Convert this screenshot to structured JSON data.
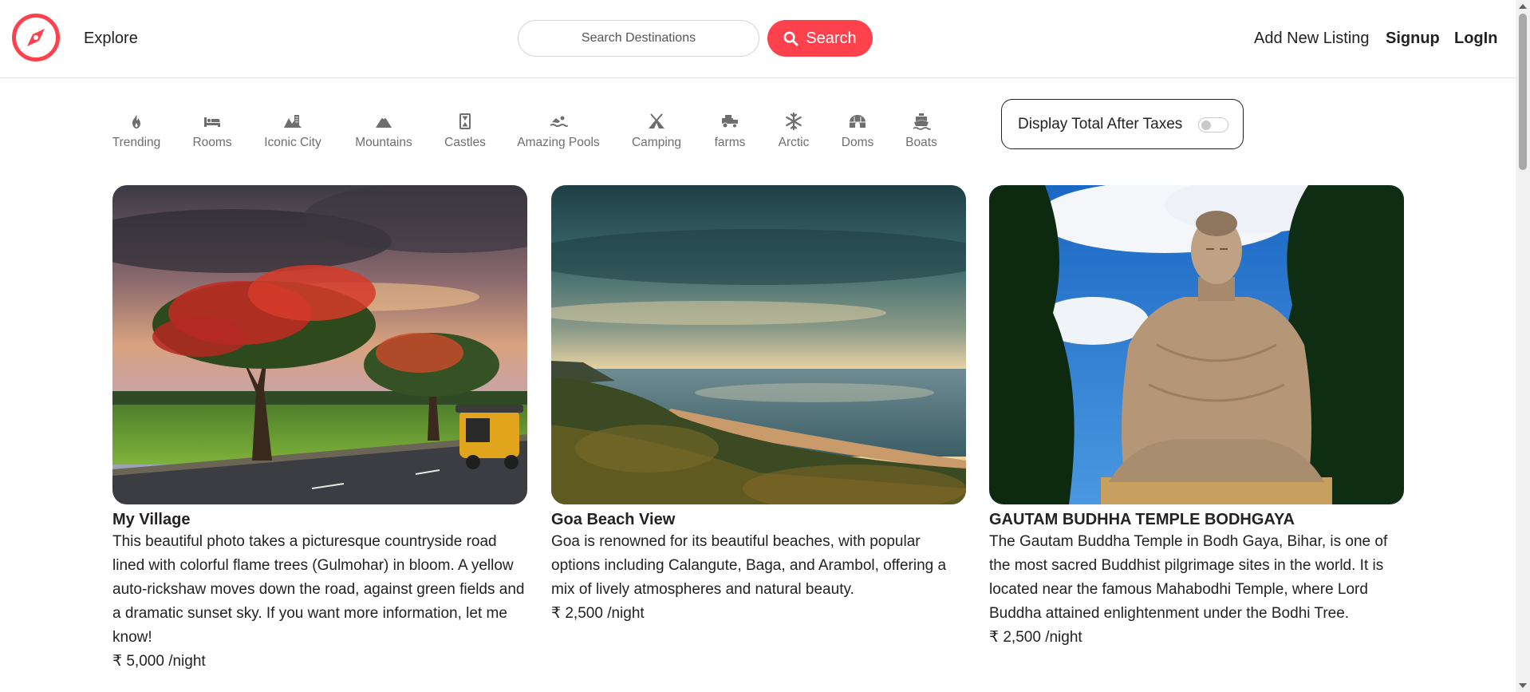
{
  "nav": {
    "explore": "Explore",
    "search_placeholder": "Search Destinations",
    "search_button": "Search",
    "add_listing": "Add New Listing",
    "signup": "Signup",
    "login": "LogIn",
    "brand_color": "#fe424d"
  },
  "filters": [
    {
      "label": "Trending",
      "icon": "fire-icon"
    },
    {
      "label": "Rooms",
      "icon": "bed-icon"
    },
    {
      "label": "Iconic City",
      "icon": "city-icon"
    },
    {
      "label": "Mountains",
      "icon": "mountain-icon"
    },
    {
      "label": "Castles",
      "icon": "castle-icon"
    },
    {
      "label": "Amazing Pools",
      "icon": "swimmer-icon"
    },
    {
      "label": "Camping",
      "icon": "tent-icon"
    },
    {
      "label": "farms",
      "icon": "tractor-icon"
    },
    {
      "label": "Arctic",
      "icon": "snowflake-icon"
    },
    {
      "label": "Doms",
      "icon": "igloo-icon"
    },
    {
      "label": "Boats",
      "icon": "ship-icon"
    }
  ],
  "tax_toggle": {
    "label": "Display Total After Taxes",
    "enabled": false
  },
  "listings": [
    {
      "title": "My Village",
      "description": "This beautiful photo takes a picturesque countryside road lined with colorful flame trees (Gulmohar) in bloom. A yellow auto-rickshaw moves down the road, against green fields and a dramatic sunset sky. If you want more information, let me know!",
      "price": "₹ 5,000 /night"
    },
    {
      "title": "Goa Beach View",
      "description": "Goa is renowned for its beautiful beaches, with popular options including Calangute, Baga, and Arambol, offering a mix of lively atmospheres and natural beauty.",
      "price": "₹ 2,500 /night"
    },
    {
      "title": "GAUTAM BUDHHA TEMPLE BODHGAYA",
      "description": "The Gautam Buddha Temple in Bodh Gaya, Bihar, is one of the most sacred Buddhist pilgrimage sites in the world. It is located near the famous Mahabodhi Temple, where Lord Buddha attained enlightenment under the Bodhi Tree.",
      "price": "₹ 2,500 /night"
    }
  ]
}
